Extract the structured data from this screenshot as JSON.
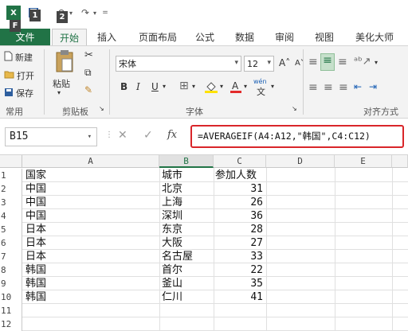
{
  "quick_access": {
    "logo": "X",
    "keytip_1": "1",
    "keytip_2": "2",
    "keytip_f": "F"
  },
  "tabs": [
    "文件",
    "开始",
    "插入",
    "页面布局",
    "公式",
    "数据",
    "审阅",
    "视图",
    "美化大师"
  ],
  "ribbon": {
    "common": {
      "new": "新建",
      "open": "打开",
      "save": "保存",
      "label": "常用"
    },
    "clipboard": {
      "paste": "粘贴",
      "label": "剪贴板"
    },
    "font": {
      "name": "宋体",
      "size": "12",
      "bold": "B",
      "italic": "I",
      "underline": "U",
      "phonetic": "wén",
      "label": "字体"
    },
    "align": {
      "label": "对齐方式"
    }
  },
  "formula_bar": {
    "cell_ref": "B15",
    "fx": "fx",
    "formula": "=AVERAGEIF(A4:A12,\"韩国\",C4:C12)"
  },
  "columns": [
    "A",
    "B",
    "C",
    "D",
    "E"
  ],
  "selected_column": "B",
  "rows": [
    {
      "num": "1",
      "a": "国家",
      "b": "城市",
      "c": "参加人数"
    },
    {
      "num": "2",
      "a": "中国",
      "b": "北京",
      "c": "31"
    },
    {
      "num": "3",
      "a": "中国",
      "b": "上海",
      "c": "26"
    },
    {
      "num": "4",
      "a": "中国",
      "b": "深圳",
      "c": "36"
    },
    {
      "num": "5",
      "a": "日本",
      "b": "东京",
      "c": "28"
    },
    {
      "num": "6",
      "a": "日本",
      "b": "大阪",
      "c": "27"
    },
    {
      "num": "7",
      "a": "日本",
      "b": "名古屋",
      "c": "33"
    },
    {
      "num": "8",
      "a": "韩国",
      "b": "首尔",
      "c": "22"
    },
    {
      "num": "9",
      "a": "韩国",
      "b": "釜山",
      "c": "35"
    },
    {
      "num": "10",
      "a": "韩国",
      "b": "仁川",
      "c": "41"
    },
    {
      "num": "11",
      "a": "",
      "b": "",
      "c": ""
    },
    {
      "num": "12",
      "a": "",
      "b": "",
      "c": ""
    }
  ],
  "colors": {
    "accent": "#217346",
    "highlight": "#d9262a"
  }
}
